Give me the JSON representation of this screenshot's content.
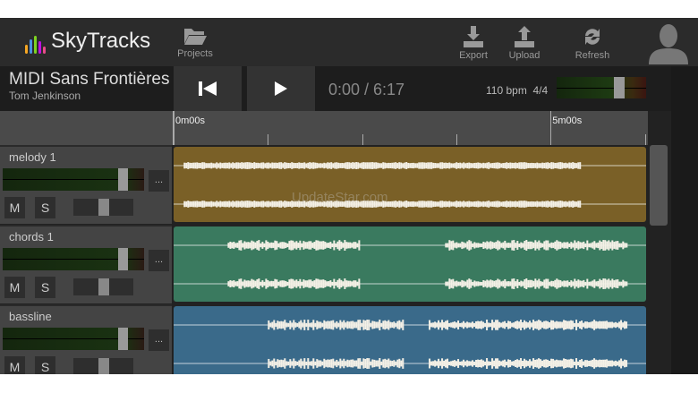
{
  "app": {
    "name": "SkyTracks",
    "logo_colors": [
      "#f5a623",
      "#4a90e2",
      "#7ed321",
      "#bd10e0",
      "#e94b8a"
    ]
  },
  "toolbar": {
    "projects": "Projects",
    "export": "Export",
    "upload": "Upload",
    "refresh": "Refresh"
  },
  "song": {
    "title": "MIDI Sans Frontières",
    "artist": "Tom Jenkinson"
  },
  "transport": {
    "time": "0:00 / 6:17",
    "tempo": "110 bpm",
    "meter": "4/4",
    "master_volume": 0.7
  },
  "timeline": {
    "duration_s": 376,
    "labels": [
      {
        "text": "0m00s",
        "s": 0
      },
      {
        "text": "5m00s",
        "s": 300
      }
    ],
    "ticks_s": [
      75,
      150,
      225,
      375
    ]
  },
  "tracks": [
    {
      "name": "melody 1",
      "color": "#7a6027",
      "volume": 0.85,
      "pan": 0.5,
      "more": "...",
      "mute": "M",
      "solo": "S",
      "regions": [
        [
          8,
          324
        ]
      ]
    },
    {
      "name": "chords 1",
      "color": "#3a7a5f",
      "volume": 0.85,
      "pan": 0.5,
      "more": "...",
      "mute": "M",
      "solo": "S",
      "regions": [
        [
          43,
          147
        ],
        [
          216,
          360
        ]
      ]
    },
    {
      "name": "bassline",
      "color": "#3a6a8a",
      "volume": 0.85,
      "pan": 0.5,
      "more": "...",
      "mute": "M",
      "solo": "S",
      "regions": [
        [
          75,
          182
        ],
        [
          203,
          360
        ]
      ]
    }
  ],
  "watermark": "UpdateStar.com"
}
